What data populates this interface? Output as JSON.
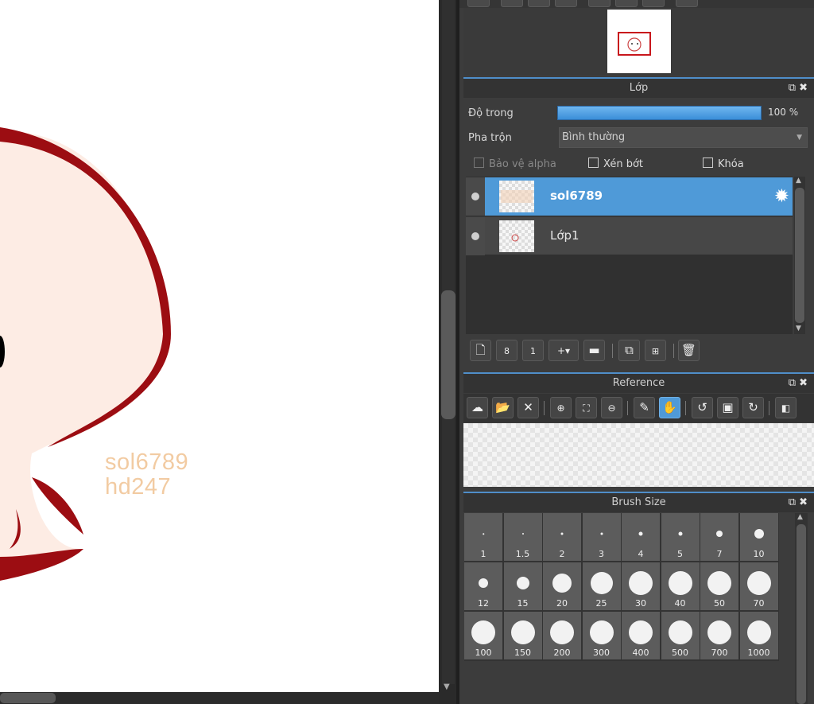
{
  "canvas": {
    "watermark_line1": "sol6789",
    "watermark_line2": "hd247"
  },
  "layer_panel": {
    "title": "Lớp",
    "opacity_label": "Độ trong",
    "opacity_value": "100 %",
    "opacity_fraction": 1.0,
    "blend_label": "Pha trộn",
    "blend_value": "Bình thường",
    "protect_alpha_label": "Bảo vệ alpha",
    "clipping_label": "Xén bớt",
    "lock_label": "Khóa",
    "layers": [
      {
        "name": "sol6789",
        "selected": true
      },
      {
        "name": "Lớp1",
        "selected": false
      }
    ]
  },
  "reference_panel": {
    "title": "Reference"
  },
  "brush_panel": {
    "title": "Brush Size",
    "sizes": [
      "1",
      "1.5",
      "2",
      "3",
      "4",
      "5",
      "7",
      "10",
      "12",
      "15",
      "20",
      "25",
      "30",
      "40",
      "50",
      "70",
      "100",
      "150",
      "200",
      "300",
      "400",
      "500",
      "700",
      "1000"
    ]
  },
  "colors": {
    "accent": "#4f9ad8",
    "stroke_dark_red": "#9c0d12",
    "skin": "#fdece4",
    "watermark": "#f2cba2"
  }
}
